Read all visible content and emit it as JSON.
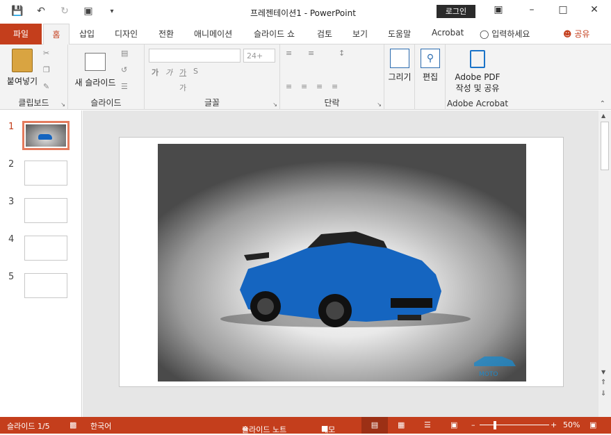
{
  "window": {
    "title": "프레젠테이션1  -  PowerPoint",
    "login_label": "로그인"
  },
  "qat": {
    "save_icon": "floppy-disk-icon",
    "undo_icon": "undo-icon",
    "redo_icon": "redo-icon",
    "present_icon": "start-presentation-icon",
    "customize_icon": "chevron-down-icon"
  },
  "tabs": {
    "file": "파일",
    "home": "홈",
    "items": [
      "삽입",
      "디자인",
      "전환",
      "애니메이션",
      "슬라이드 쇼",
      "검토",
      "보기",
      "도움말",
      "Acrobat"
    ],
    "tell_me": "입력하세요",
    "share": "공유"
  },
  "ribbon": {
    "clipboard": {
      "paste": "붙여넣기",
      "label": "클립보드"
    },
    "slides": {
      "new_slide": "새 슬라이드",
      "label": "슬라이드"
    },
    "font": {
      "size": "24+",
      "label": "글꼴",
      "buttons": [
        "가",
        "가",
        "가",
        "S",
        "가"
      ]
    },
    "paragraph": {
      "label": "단락"
    },
    "drawing": {
      "label": "그리기"
    },
    "editing": {
      "label": "편집"
    },
    "acrobat": {
      "button_line1": "Adobe PDF",
      "button_line2": "작성 및 공유",
      "label": "Adobe Acrobat"
    }
  },
  "thumbnails": {
    "numbers": [
      "1",
      "2",
      "3",
      "4",
      "5"
    ],
    "active": "1"
  },
  "slide": {
    "image_alt": "blue-sports-car-photo",
    "watermark": "MOTO"
  },
  "status": {
    "slide_info": "슬라이드 1/5",
    "language": "한국어",
    "notes": "슬라이드 노트",
    "comments": "메모",
    "zoom": "50%"
  },
  "colors": {
    "accent": "#c43e1c",
    "car_body": "#1565c0"
  }
}
